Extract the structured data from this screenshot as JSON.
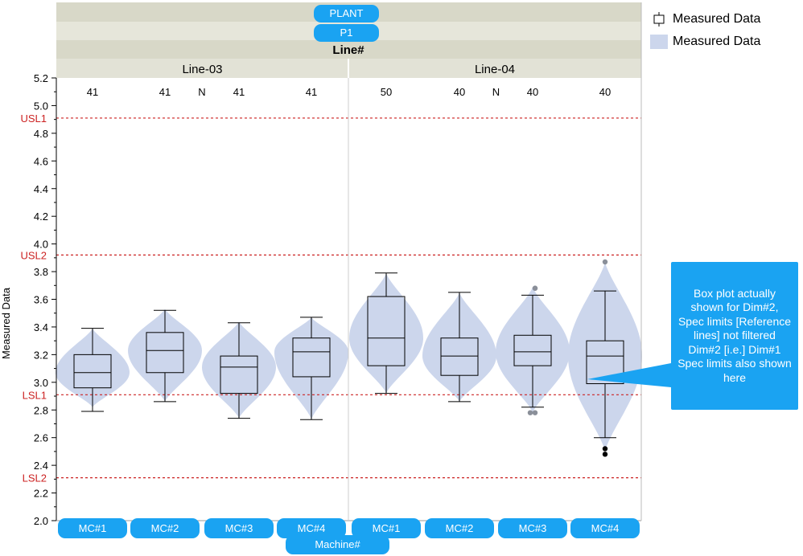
{
  "chart_data": {
    "type": "box",
    "ylabel": "Measured Data",
    "xlabel": "Machine#",
    "ylim": [
      2.0,
      5.2
    ],
    "yticks": [
      2.0,
      2.2,
      2.4,
      2.6,
      2.8,
      3.0,
      3.2,
      3.4,
      3.6,
      3.8,
      4.0,
      4.2,
      4.4,
      4.6,
      4.8,
      5.0,
      5.2
    ],
    "headers": {
      "plant": "PLANT",
      "p1": "P1",
      "line": "Line#"
    },
    "n_label": "N",
    "groups": [
      {
        "label": "Line-03",
        "boxes": [
          {
            "machine": "MC#1",
            "n": "41",
            "whisker_low": 2.79,
            "q1": 2.96,
            "median": 3.07,
            "q3": 3.2,
            "whisker_high": 3.39,
            "violin_min": 2.82,
            "violin_max": 3.39,
            "outliers": []
          },
          {
            "machine": "MC#2",
            "n": "41",
            "whisker_low": 2.86,
            "q1": 3.07,
            "median": 3.23,
            "q3": 3.36,
            "whisker_high": 3.52,
            "violin_min": 2.86,
            "violin_max": 3.53,
            "outliers": []
          },
          {
            "machine": "MC#3",
            "n": "41",
            "whisker_low": 2.74,
            "q1": 2.92,
            "median": 3.11,
            "q3": 3.19,
            "whisker_high": 3.43,
            "violin_min": 2.74,
            "violin_max": 3.44,
            "outliers": []
          },
          {
            "machine": "MC#4",
            "n": "41",
            "whisker_low": 2.73,
            "q1": 3.04,
            "median": 3.22,
            "q3": 3.32,
            "whisker_high": 3.47,
            "violin_min": 2.73,
            "violin_max": 3.47,
            "outliers": []
          }
        ]
      },
      {
        "label": "Line-04",
        "boxes": [
          {
            "machine": "MC#1",
            "n": "50",
            "whisker_low": 2.92,
            "q1": 3.12,
            "median": 3.32,
            "q3": 3.62,
            "whisker_high": 3.79,
            "violin_min": 2.92,
            "violin_max": 3.79,
            "outliers": []
          },
          {
            "machine": "MC#2",
            "n": "40",
            "whisker_low": 2.86,
            "q1": 3.05,
            "median": 3.19,
            "q3": 3.32,
            "whisker_high": 3.65,
            "violin_min": 2.86,
            "violin_max": 3.65,
            "outliers": []
          },
          {
            "machine": "MC#3",
            "n": "40",
            "whisker_low": 2.82,
            "q1": 3.12,
            "median": 3.22,
            "q3": 3.34,
            "whisker_high": 3.63,
            "violin_min": 2.78,
            "violin_max": 3.69,
            "outliers": [
              2.78,
              3.68
            ]
          },
          {
            "machine": "MC#4",
            "n": "40",
            "whisker_low": 2.6,
            "q1": 2.99,
            "median": 3.19,
            "q3": 3.3,
            "whisker_high": 3.66,
            "violin_min": 2.5,
            "violin_max": 3.87,
            "outliers": [
              3.87,
              2.52,
              2.48
            ]
          }
        ]
      }
    ],
    "reference_lines": [
      {
        "label": "USL1",
        "value": 4.91
      },
      {
        "label": "USL2",
        "value": 3.92
      },
      {
        "label": "LSL1",
        "value": 2.91
      },
      {
        "label": "LSL2",
        "value": 2.31
      }
    ],
    "legend": [
      {
        "label": "Measured Data",
        "symbol": "box"
      },
      {
        "label": "Measured Data",
        "symbol": "violin"
      }
    ],
    "colors": {
      "violin": "#ccd6ec",
      "ref_line": "#cc2222",
      "header_bg": "#d9d9c9",
      "pill": "#1aa3f2"
    },
    "callout": {
      "text": "Box plot actually shown for Dim#2, Spec limits [Reference lines] not filtered Dim#2 [i.e.] Dim#1 Spec limits also shown here"
    }
  }
}
